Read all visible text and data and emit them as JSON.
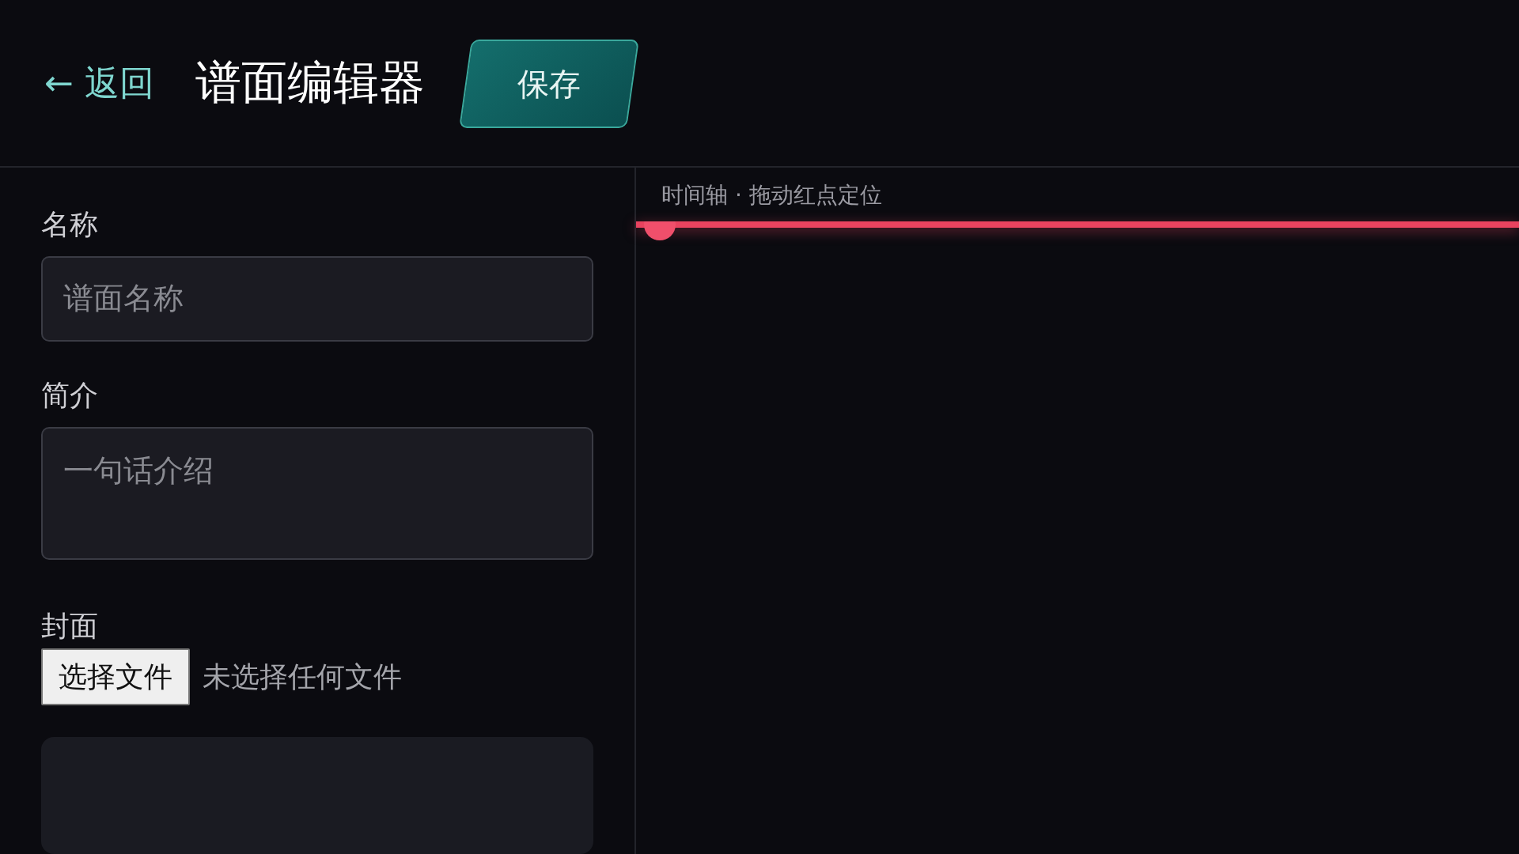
{
  "header": {
    "back": "← 返回",
    "title": "谱面编辑器",
    "save": "保存"
  },
  "form": {
    "name": {
      "label": "名称",
      "placeholder": "谱面名称"
    },
    "intro": {
      "label": "简介",
      "placeholder": "一句话介绍"
    },
    "cover": {
      "label": "封面",
      "button": "选择文件",
      "status": "未选择任何文件"
    }
  },
  "timeline": {
    "caption": "时间轴 · 拖动红点定位",
    "level": 0
  }
}
